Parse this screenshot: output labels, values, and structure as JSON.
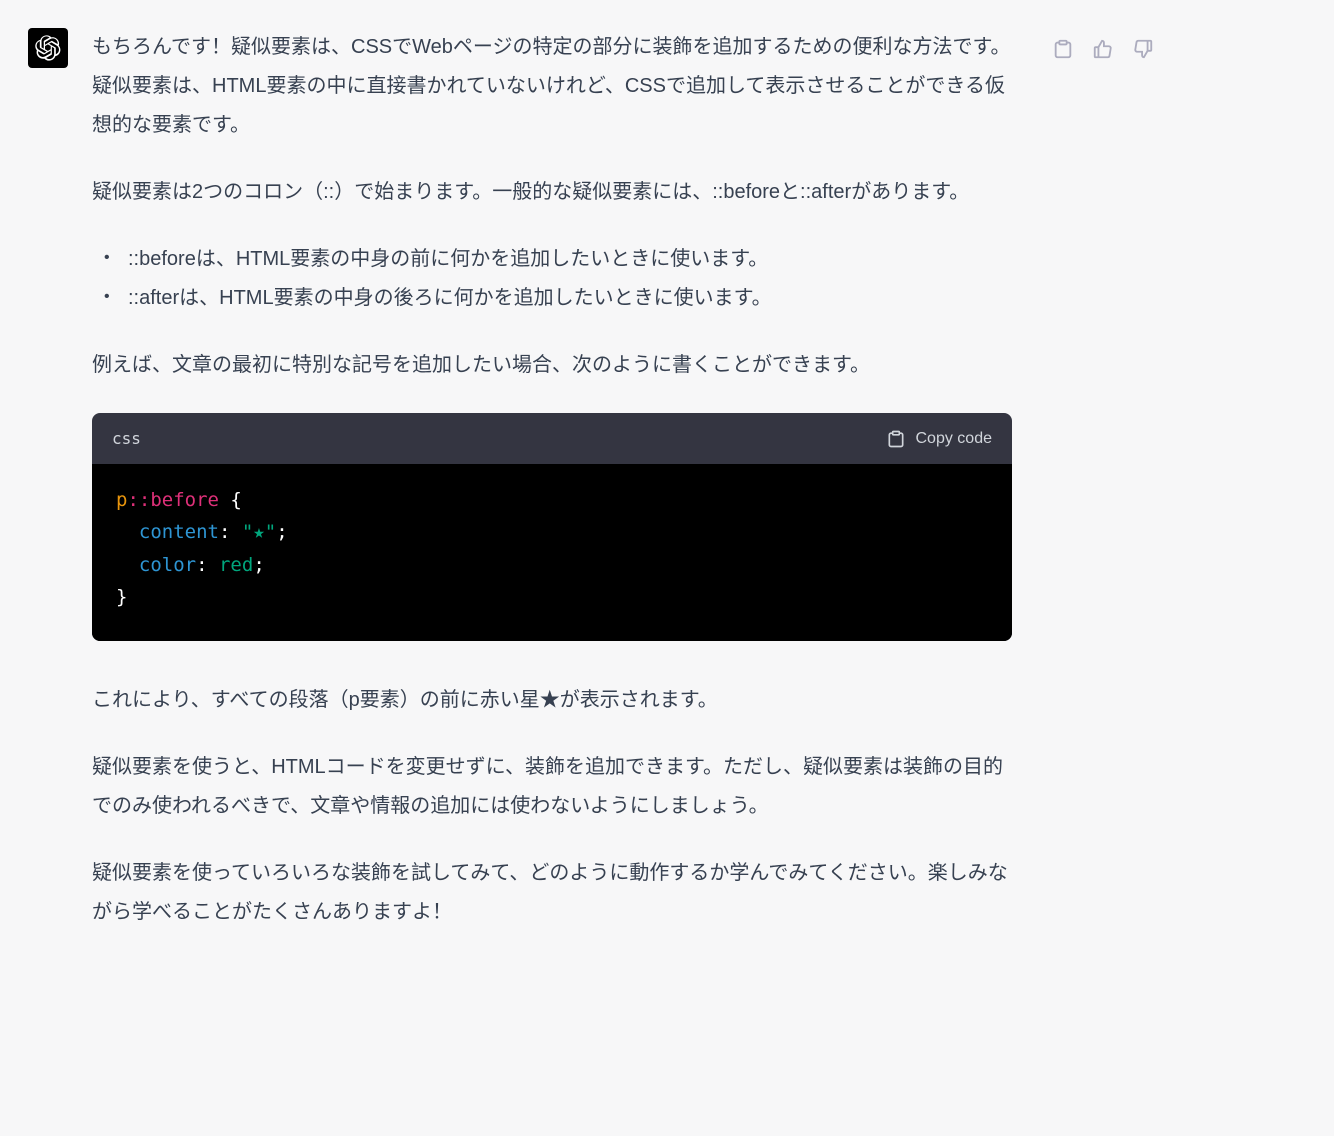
{
  "message": {
    "p1": "もちろんです！疑似要素は、CSSでWebページの特定の部分に装飾を追加するための便利な方法です。疑似要素は、HTML要素の中に直接書かれていないけれど、CSSで追加して表示させることができる仮想的な要素です。",
    "p2": "疑似要素は2つのコロン（::）で始まります。一般的な疑似要素には、::beforeと::afterがあります。",
    "li1": "::beforeは、HTML要素の中身の前に何かを追加したいときに使います。",
    "li2": "::afterは、HTML要素の中身の後ろに何かを追加したいときに使います。",
    "p3": "例えば、文章の最初に特別な記号を追加したい場合、次のように書くことができます。",
    "p4": "これにより、すべての段落（p要素）の前に赤い星★が表示されます。",
    "p5": "疑似要素を使うと、HTMLコードを変更せずに、装飾を追加できます。ただし、疑似要素は装飾の目的でのみ使われるべきで、文章や情報の追加には使わないようにしましょう。",
    "p6": "疑似要素を使っていろいろな装飾を試してみて、どのように動作するか学んでみてください。楽しみながら学べることがたくさんありますよ！"
  },
  "code": {
    "lang": "css",
    "copy_label": "Copy code",
    "line1_selector": "p",
    "line1_pseudo": "::before",
    "line1_brace": " {",
    "line2_indent": "  ",
    "line2_prop": "content",
    "line2_colon": ": ",
    "line2_value": "\"★\"",
    "line2_semi": ";",
    "line3_indent": "  ",
    "line3_prop": "color",
    "line3_colon": ": ",
    "line3_value": "red",
    "line3_semi": ";",
    "line4_brace": "}"
  }
}
